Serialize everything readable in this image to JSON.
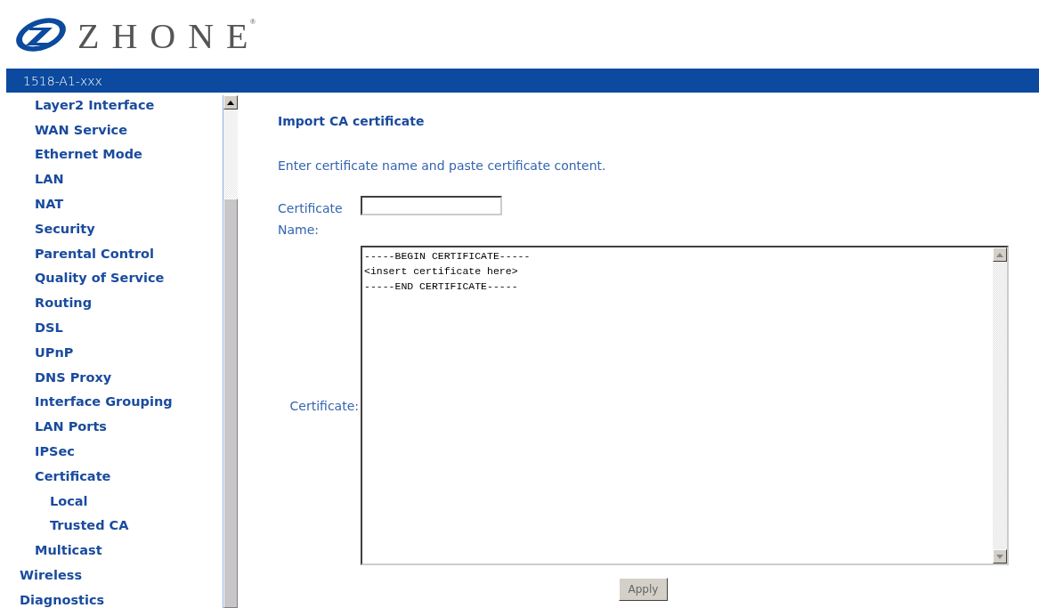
{
  "logo": {
    "text": "ZHONE",
    "mark": "®"
  },
  "header_bar": {
    "title": "1518-A1-xxx"
  },
  "sidebar": {
    "sections": [
      {
        "children": [
          {
            "label": "Layer2 Interface"
          },
          {
            "label": "WAN Service"
          },
          {
            "label": "Ethernet Mode"
          },
          {
            "label": "LAN"
          },
          {
            "label": "NAT"
          },
          {
            "label": "Security"
          },
          {
            "label": "Parental Control"
          },
          {
            "label": "Quality of Service"
          },
          {
            "label": "Routing"
          },
          {
            "label": "DSL"
          },
          {
            "label": "UPnP"
          },
          {
            "label": "DNS Proxy"
          },
          {
            "label": "Interface Grouping"
          },
          {
            "label": "LAN Ports"
          },
          {
            "label": "IPSec"
          },
          {
            "label": "Certificate",
            "children": [
              {
                "label": "Local"
              },
              {
                "label": "Trusted CA"
              }
            ]
          },
          {
            "label": "Multicast"
          }
        ]
      },
      {
        "label": "Wireless"
      },
      {
        "label": "Diagnostics"
      }
    ]
  },
  "main": {
    "title": "Import CA certificate",
    "instruction": "Enter certificate name and paste certificate content.",
    "name_field": {
      "label": "Certificate Name:"
    },
    "certificate_field": {
      "label": "Certificate:",
      "value": "-----BEGIN CERTIFICATE-----\n<insert certificate here>\n-----END CERTIFICATE-----"
    },
    "buttons": [
      "Apply"
    ]
  }
}
